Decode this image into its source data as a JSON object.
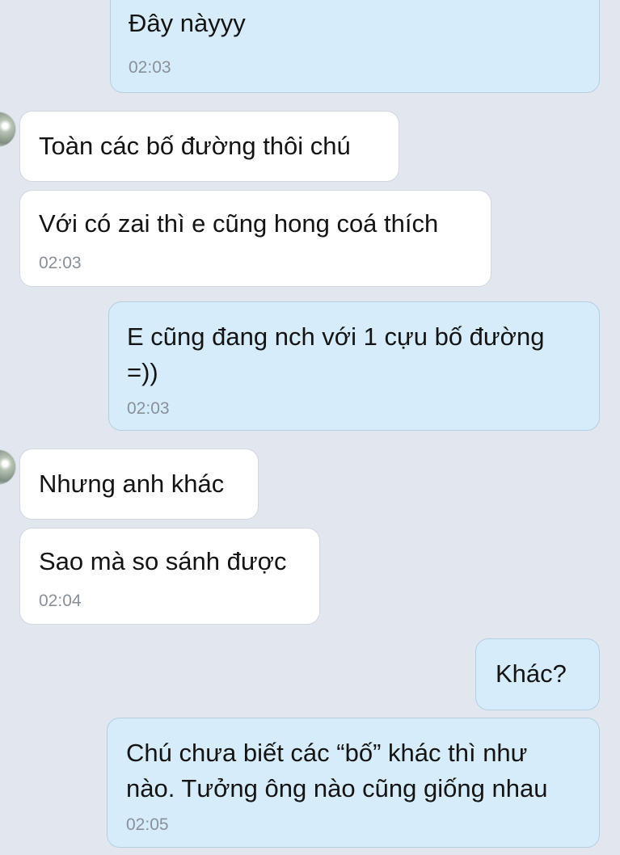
{
  "messages": [
    {
      "id": 1,
      "side": "outgoing",
      "text": "Đây nàyyy",
      "time": "02:03"
    },
    {
      "id": 2,
      "side": "incoming",
      "text": "Toàn các bố đường thôi chú",
      "time": ""
    },
    {
      "id": 3,
      "side": "incoming",
      "text": "Với có zai thì e cũng hong coá thích",
      "time": "02:03"
    },
    {
      "id": 4,
      "side": "outgoing",
      "text": "E cũng đang nch với 1 cựu bố đường =))",
      "time": "02:03"
    },
    {
      "id": 5,
      "side": "incoming",
      "text": "Nhưng anh khác",
      "time": ""
    },
    {
      "id": 6,
      "side": "incoming",
      "text": "Sao mà so sánh được",
      "time": "02:04"
    },
    {
      "id": 7,
      "side": "outgoing",
      "text": "Khác?",
      "time": ""
    },
    {
      "id": 8,
      "side": "outgoing",
      "text": "Chú chưa biết các “bố” khác thì như nào. Tưởng ông nào cũng giống nhau",
      "time": "02:05"
    }
  ],
  "avatars": [
    {
      "icon": "contact-avatar-icon"
    },
    {
      "icon": "contact-avatar-icon"
    }
  ],
  "colors": {
    "background": "#e2e7ef",
    "incoming_bubble": "#ffffff",
    "outgoing_bubble": "#d6ecfa",
    "timestamp": "#8a9099"
  }
}
